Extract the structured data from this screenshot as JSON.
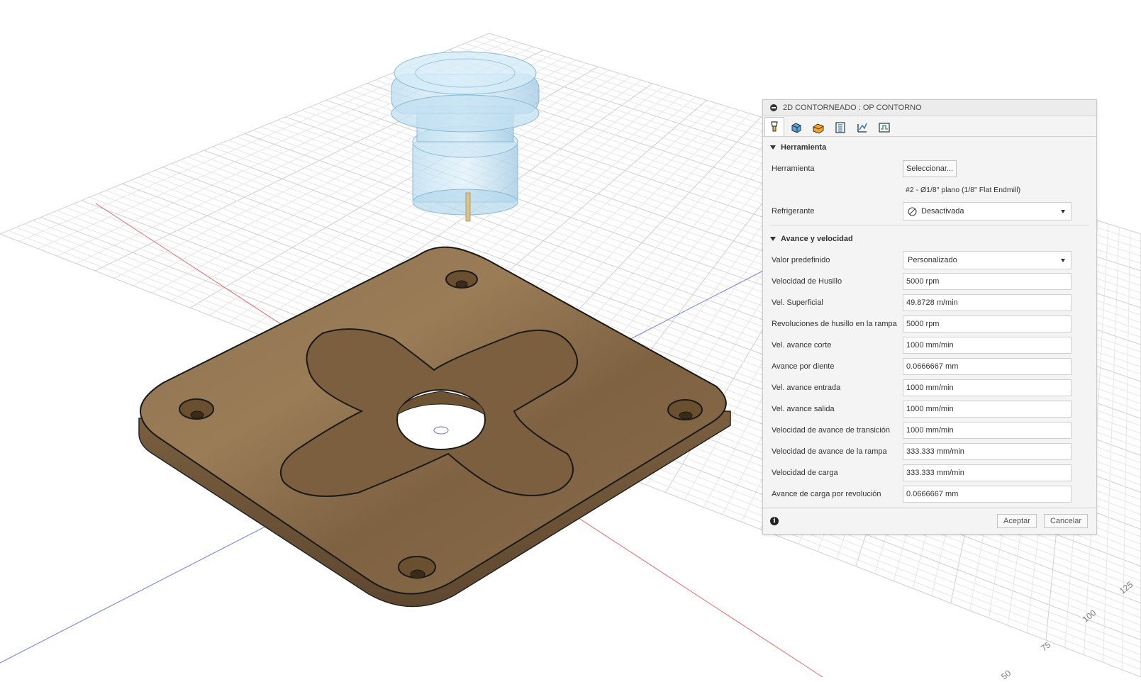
{
  "dialog": {
    "title": "2D CONTORNEADO : OP CONTORNO",
    "tabs": [
      {
        "icon": "tool-icon",
        "active": true
      },
      {
        "icon": "geometry-icon",
        "active": false
      },
      {
        "icon": "heights-icon",
        "active": false
      },
      {
        "icon": "passes-icon",
        "active": false
      },
      {
        "icon": "linking-icon",
        "active": false
      },
      {
        "icon": "post-icon",
        "active": false
      }
    ],
    "tool_section": {
      "heading": "Herramienta",
      "tool_label": "Herramienta",
      "select_button": "Seleccionar...",
      "tool_description": "#2 - Ø1/8\" plano (1/8\" Flat Endmill)",
      "coolant_label": "Refrigerante",
      "coolant_value": "Desactivada"
    },
    "feed_section": {
      "heading": "Avance y velocidad",
      "preset_label": "Valor predefinido",
      "preset_value": "Personalizado",
      "fields": [
        {
          "label": "Velocidad de Husillo",
          "value": "5000 rpm"
        },
        {
          "label": "Vel. Superficial",
          "value": "49.8728 m/min"
        },
        {
          "label": "Revoluciones de husillo en la rampa",
          "value": "5000 rpm"
        },
        {
          "label": "Vel. avance corte",
          "value": "1000 mm/min"
        },
        {
          "label": "Avance por diente",
          "value": "0.0666667 mm"
        },
        {
          "label": "Vel. avance entrada",
          "value": "1000 mm/min"
        },
        {
          "label": "Vel. avance salida",
          "value": "1000 mm/min"
        },
        {
          "label": "Velocidad de avance de transición",
          "value": "1000 mm/min"
        },
        {
          "label": "Velocidad de avance de la rampa",
          "value": "333.333 mm/min"
        },
        {
          "label": "Velocidad de carga",
          "value": "333.333 mm/min"
        },
        {
          "label": "Avance de carga por revolución",
          "value": "0.0666667 mm"
        }
      ]
    },
    "footer": {
      "info_icon": "i",
      "ok_label": "Aceptar",
      "cancel_label": "Cancelar"
    }
  },
  "viewport": {
    "axis_ticks": [
      "125",
      "100",
      "75",
      "50"
    ],
    "colors": {
      "wood": "#8a6c47",
      "wood_dark": "#6b5232",
      "tool_body": "#a8d2ea",
      "grid": "#d9d9d9",
      "x_axis": "#e05a5a",
      "y_axis": "#5a6ee0"
    }
  }
}
